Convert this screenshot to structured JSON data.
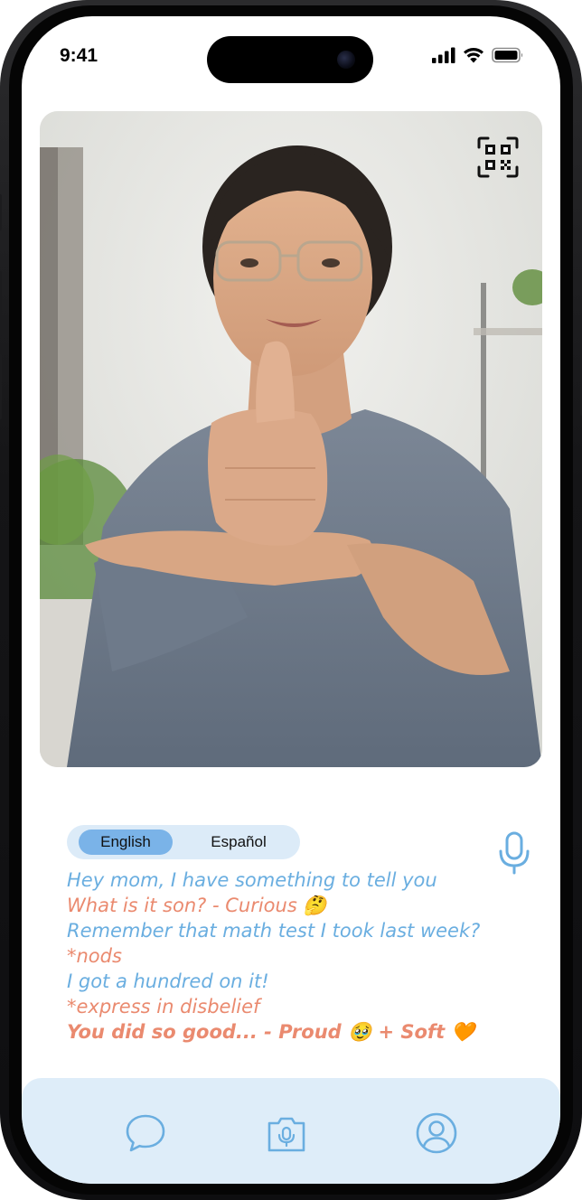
{
  "status_bar": {
    "time": "9:41",
    "icons": [
      "cellular-signal-icon",
      "wifi-icon",
      "battery-icon"
    ]
  },
  "video": {
    "content": "person-signing-camera-feed",
    "qr_icon": "qr-code-icon"
  },
  "language_toggle": {
    "options": [
      {
        "label": "English",
        "active": true
      },
      {
        "label": "Español",
        "active": false
      }
    ]
  },
  "mic_icon": "microphone-icon",
  "transcript": {
    "lines": [
      {
        "text": "Hey mom, I have something to tell you",
        "speaker_color": "#6aaee0"
      },
      {
        "text": "What is it son? - Curious 🤔",
        "speaker_color": "#ea8a6f"
      },
      {
        "text": "Remember that math test I took last week?",
        "speaker_color": "#6aaee0"
      },
      {
        "text": "*nods",
        "speaker_color": "#ea8a6f"
      },
      {
        "text": "I got a hundred on it!",
        "speaker_color": "#6aaee0"
      },
      {
        "text": "*express in disbelief",
        "speaker_color": "#ea8a6f"
      },
      {
        "text": "You did so good... - Proud 🥹 + Soft 🧡",
        "speaker_color": "#ea8a6f",
        "bold": true
      }
    ]
  },
  "tab_bar": {
    "tabs": [
      "chat-bubble-icon",
      "camera-mic-icon",
      "profile-icon"
    ]
  },
  "colors": {
    "accent_blue": "#6aaee0",
    "accent_orange": "#ea8a6f",
    "toggle_active": "#7ab3e8",
    "tab_bar_bg": "#deedf9"
  }
}
